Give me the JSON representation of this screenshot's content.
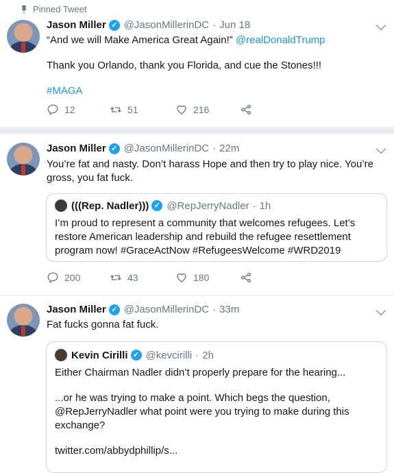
{
  "pinned_label": "Pinned Tweet",
  "tweets": [
    {
      "name": "Jason Miller",
      "handle": "@JasonMillerinDC",
      "time": "Jun 18",
      "text_parts": [
        "“And we will Make America Great Again!” ",
        "@realDonaldTrump"
      ],
      "line2": "Thank you Orlando, thank you Florida, and cue the Stones!!!",
      "hashtag": "#MAGA",
      "replies": "12",
      "retweets": "51",
      "likes": "216"
    },
    {
      "name": "Jason Miller",
      "handle": "@JasonMillerinDC",
      "time": "22m",
      "text": "You’re fat and nasty. Don’t harass Hope and then try to play nice. You’re gross, you fat fuck.",
      "quote": {
        "name": "(((Rep. Nadler)))",
        "handle": "@RepJerryNadler",
        "time": "1h",
        "text": "I’m proud to represent a community that welcomes refugees. Let’s restore American leadership and rebuild the refugee resettlement program now! #GraceActNow #RefugeesWelcome #WRD2019"
      },
      "replies": "200",
      "retweets": "43",
      "likes": "180"
    },
    {
      "name": "Jason Miller",
      "handle": "@JasonMillerinDC",
      "time": "33m",
      "text": "Fat fucks gonna fat fuck.",
      "quote": {
        "name": "Kevin Cirilli",
        "handle": "@kevcirilli",
        "time": "2h",
        "p1": "Either Chairman Nadler didn’t properly prepare for the hearing...",
        "p2": "...or he was trying to make a point. Which begs the question, @RepJerryNadler what point were you trying to make during this exchange?",
        "p3": "twitter.com/abbydphillip/s..."
      }
    }
  ],
  "separator": "·",
  "verified_mark": "✓"
}
